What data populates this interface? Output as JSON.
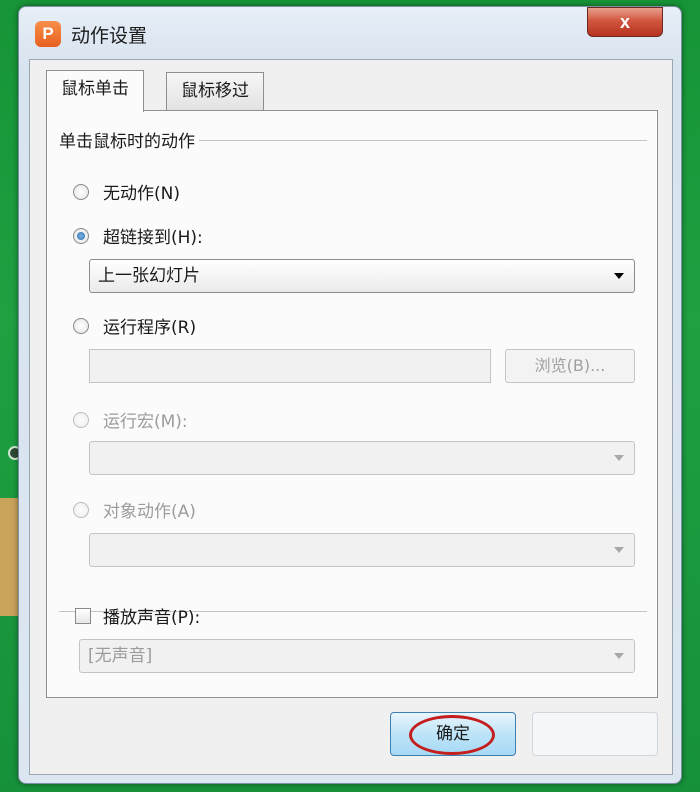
{
  "window": {
    "title": "动作设置",
    "app_icon_letter": "P",
    "close_label": "x"
  },
  "tabs": [
    {
      "label": "鼠标单击",
      "active": true
    },
    {
      "label": "鼠标移过",
      "active": false
    }
  ],
  "group_title": "单击鼠标时的动作",
  "options": {
    "none": {
      "label": "无动作(N)",
      "checked": false,
      "enabled": true
    },
    "hyperlink": {
      "label": "超链接到(H):",
      "checked": true,
      "enabled": true,
      "selected_value": "上一张幻灯片"
    },
    "run_program": {
      "label": "运行程序(R)",
      "checked": false,
      "enabled": true,
      "browse_label": "浏览(B)..."
    },
    "run_macro": {
      "label": "运行宏(M):",
      "checked": false,
      "enabled": false
    },
    "object_action": {
      "label": "对象动作(A)",
      "checked": false,
      "enabled": false
    }
  },
  "sound": {
    "label": "播放声音(P):",
    "checked": false,
    "selected_value": "[无声音]"
  },
  "buttons": {
    "ok_label": "确定"
  },
  "colors": {
    "highlight_circle": "#c41e1e",
    "background_green": "#1f9a3c"
  }
}
